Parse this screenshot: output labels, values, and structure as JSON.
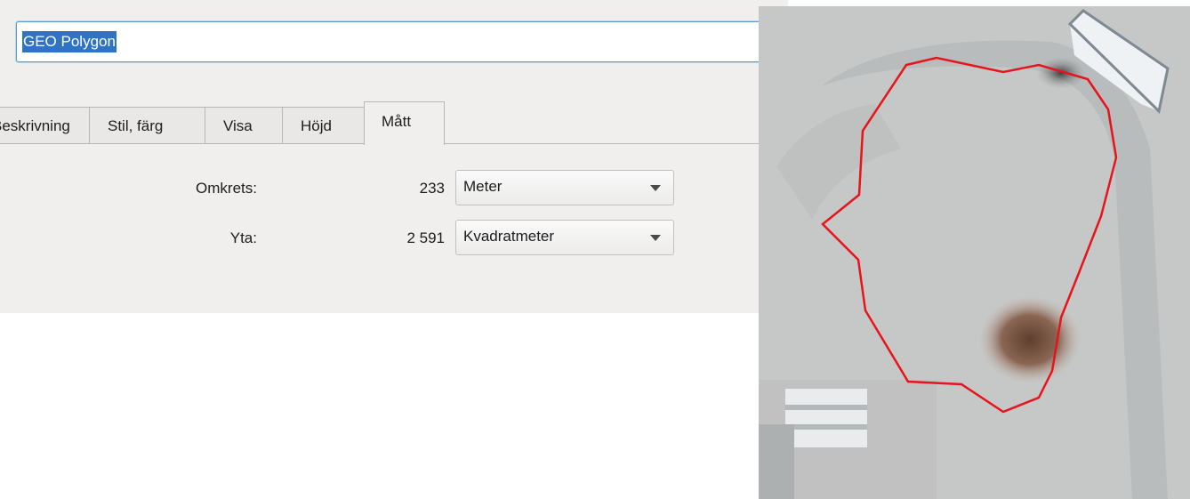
{
  "name_field": {
    "value": "GEO Polygon"
  },
  "tabs": [
    {
      "label": "Beskrivning"
    },
    {
      "label": "Stil, färg"
    },
    {
      "label": "Visa"
    },
    {
      "label": "Höjd"
    },
    {
      "label": "Mått"
    }
  ],
  "active_tab": "Mått",
  "measurements": {
    "perimeter": {
      "label": "Omkrets:",
      "value": "233",
      "unit": "Meter"
    },
    "area": {
      "label": "Yta:",
      "value": "2 591",
      "unit": "Kvadratmeter"
    }
  },
  "map": {
    "polygon_color": "#e8141c",
    "imagery": "satellite"
  }
}
